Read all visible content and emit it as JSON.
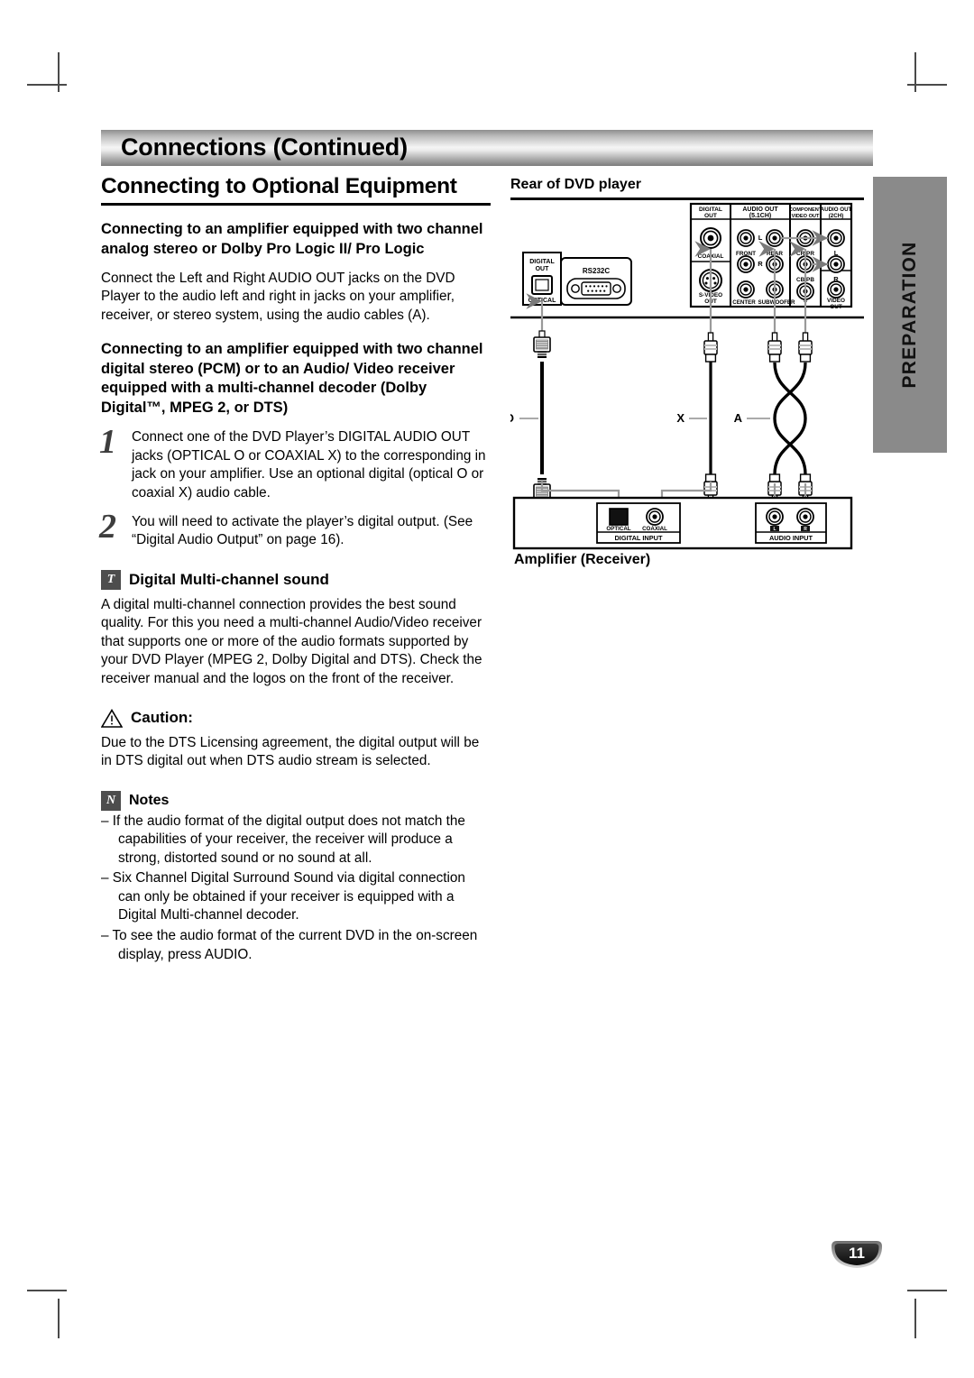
{
  "header": {
    "title": "Connections (Continued)"
  },
  "sidebar_tab": {
    "label": "PREPARATION"
  },
  "page_badge": {
    "number": "11"
  },
  "content": {
    "section_title": "Connecting to Optional Equipment",
    "sub1_heading": "Connecting to an amplifier equipped with two channel analog stereo or Dolby Pro Logic II/ Pro Logic",
    "sub1_body": "Connect the Left and Right AUDIO OUT jacks on the DVD Player to the audio left and right in jacks on your amplifier, receiver, or stereo system, using the audio cables (A).",
    "sub2_heading": "Connecting to an amplifier equipped with two channel digital stereo (PCM) or to an Audio/ Video receiver equipped with a multi-channel decoder (Dolby Digital™, MPEG 2, or DTS)",
    "steps": [
      {
        "num": "1",
        "text": "Connect one of the DVD Player’s DIGITAL AUDIO OUT jacks (OPTICAL O or COAXIAL X) to the corresponding in jack on your amplifier. Use an optional digital (optical O or coaxial X) audio cable."
      },
      {
        "num": "2",
        "text": "You will need to activate the player’s digital output. (See “Digital Audio Output” on page 16)."
      }
    ],
    "tip_icon_glyph": "T",
    "tip_heading": "Digital Multi-channel sound",
    "tip_body": "A digital multi-channel connection provides the best sound quality. For this you need a multi-channel Audio/Video receiver that supports one or more of the audio formats supported by your DVD Player (MPEG 2, Dolby Digital and DTS). Check the receiver manual and the logos on the front of the receiver.",
    "caution_heading": "Caution:",
    "caution_body": "Due to the DTS Licensing agreement, the digital output will be in DTS digital out when DTS audio stream is selected.",
    "notes_icon_glyph": "N",
    "notes_heading": "Notes",
    "notes": [
      "– If the audio format of the digital output does not match the capabilities of your receiver, the receiver will produce a strong, distorted sound or no sound at all.",
      "– Six Channel Digital Surround Sound via digital connection can only be obtained if your receiver is equipped with a Digital Multi-channel decoder.",
      "– To see the audio format of the current DVD in the on-screen display, press AUDIO."
    ]
  },
  "diagram": {
    "top_caption": "Rear of DVD player",
    "bottom_caption": "Amplifier (Receiver)",
    "left_panel": {
      "digital_out_label": "DIGITAL\nOUT",
      "optical_label": "OPTICAL",
      "rs232c_label": "RS232C"
    },
    "rear_panel_groups": [
      {
        "title": "DIGITAL\nOUT",
        "jacks": [
          {
            "label": "COAXIAL",
            "type": "rca"
          },
          {
            "label": "S-VIDEO\nOUT",
            "type": "svideo"
          }
        ]
      },
      {
        "title": "AUDIO OUT\n(5.1CH)",
        "jacks": [
          {
            "label": "FRONT",
            "type": "rca",
            "side": "L"
          },
          {
            "label": "REAR",
            "type": "rca",
            "side": "L"
          },
          {
            "label": "",
            "type": "rca",
            "side": "R"
          },
          {
            "label": "",
            "type": "rca",
            "side": "R"
          },
          {
            "label": "CENTER",
            "type": "rca"
          },
          {
            "label": "SUBWOOFER",
            "type": "rca"
          }
        ]
      },
      {
        "title": "COMPONENT\nVIDEO OUT",
        "jacks": [
          {
            "label": "CR/PR",
            "type": "rca"
          },
          {
            "label": "CB/PB",
            "type": "rca"
          },
          {
            "label": "Y",
            "type": "rca"
          }
        ]
      },
      {
        "title": "AUDIO OUT\n(2CH)",
        "jacks": [
          {
            "label": "L",
            "type": "rca"
          },
          {
            "label": "R",
            "type": "rca"
          },
          {
            "label": "VIDEO\nOUT",
            "type": "rca"
          }
        ]
      }
    ],
    "cables": [
      {
        "id": "O",
        "kind": "optical",
        "label": "O"
      },
      {
        "id": "X",
        "kind": "coaxial",
        "label": "X"
      },
      {
        "id": "A",
        "kind": "stereo-pair",
        "label": "A"
      }
    ],
    "amplifier": {
      "digital_input_label": "DIGITAL INPUT",
      "digital_jacks": [
        {
          "label": "OPTICAL",
          "type": "toslink"
        },
        {
          "label": "COAXIAL",
          "type": "rca"
        }
      ],
      "audio_input_label": "AUDIO INPUT",
      "audio_jacks": [
        {
          "label": "L"
        },
        {
          "label": "R"
        }
      ]
    }
  },
  "colors": {
    "tab_gray": "#8a8a8a",
    "rule_black": "#000000",
    "step_number_gray": "#3d3d3d"
  }
}
